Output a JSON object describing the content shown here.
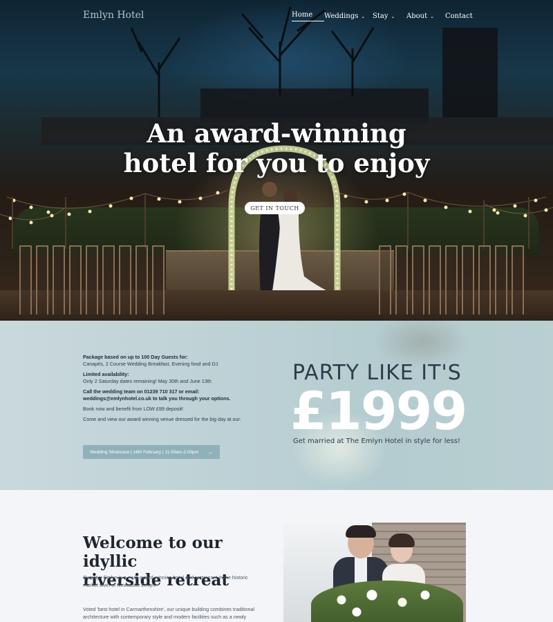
{
  "nav": {
    "logo": "Emlyn Hotel",
    "items": [
      {
        "label": "Home",
        "has_dropdown": false,
        "active": true
      },
      {
        "label": "Weddings",
        "has_dropdown": true,
        "active": false
      },
      {
        "label": "Stay",
        "has_dropdown": true,
        "active": false
      },
      {
        "label": "About",
        "has_dropdown": true,
        "active": false
      },
      {
        "label": "Contact",
        "has_dropdown": false,
        "active": false
      }
    ]
  },
  "hero": {
    "title_line1": "An award-winning",
    "title_line2": "hotel for you to enjoy",
    "cta_label": "GET IN TOUCH"
  },
  "promo": {
    "package_heading": "Package based on up to 100 Day Guests for:",
    "package_items": "Canapés, 2 Course Wedding Breakfast, Evening food and DJ",
    "availability_heading": "Limited availability:",
    "availability_text": "Only 2 Saturday dates remaining! May 30th and June 13th",
    "call_text": "Call the wedding team on 01239 710 317 or email:",
    "email_text": "weddings@emlynhotel.co.uk to talk you through your options.",
    "deposit_text": "Book now and benefit from LOW £99 deposit!",
    "showcase_intro": "Come and view our award winning venue dressed for the big day at our:",
    "showcase_button": "Wedding Showcase | 16th February | 11.00am-2.00pm",
    "showcase_arrow": "→",
    "party_heading": "PARTY LIKE IT'S",
    "price": "£1999",
    "tagline": "Get married at The Emlyn Hotel in style for less!"
  },
  "welcome": {
    "title_line1": "Welcome to our idyllic",
    "title_line2": "riverside retreat",
    "paragraph1": "Gwesty'r Emlyn is a multi award-winning hotel and restaurant in the historic market town of Newcastle Emlyn.",
    "paragraph2": "Voted 'best hotel in Carmarthenshire', our unique building combines traditional architecture with contemporary style and modern facilities such as a newly"
  },
  "icons": {
    "dropdown": "chevron-down-icon",
    "arrow": "arrow-right-icon"
  },
  "colors": {
    "promo_button": "#8fb1b9",
    "party_text": "#2e3c4a",
    "title_text": "#1f2630"
  }
}
